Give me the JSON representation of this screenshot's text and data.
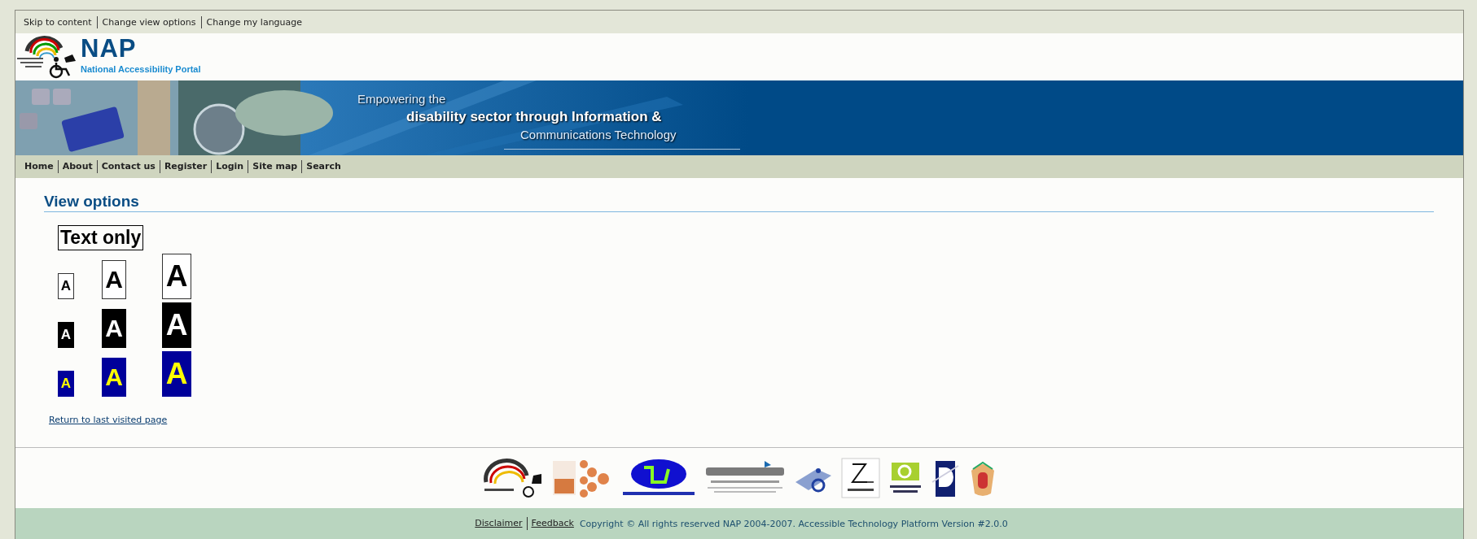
{
  "skip_links": [
    "Skip to content",
    "Change view options",
    "Change my language"
  ],
  "logo": {
    "name": "NAP",
    "subtitle": "National Accessibility Portal"
  },
  "banner": {
    "kind": "picture",
    "tagline": [
      "Empowering the",
      "disability sector through Information &",
      "Communications Technology"
    ]
  },
  "nav": [
    "Home",
    "About",
    "Contact us",
    "Register",
    "Login",
    "Site map",
    "Search"
  ],
  "view_options": {
    "title": "View options",
    "text_only": "Text only",
    "schemes": [
      {
        "kind": "outline",
        "sizes": [
          "A",
          "A",
          "A"
        ]
      },
      {
        "kind": "inverse",
        "sizes": [
          "A",
          "A",
          "A"
        ]
      },
      {
        "kind": "yellow-on-blue",
        "sizes": [
          "A",
          "A",
          "A"
        ]
      }
    ],
    "return_link": "Return to last visited page"
  },
  "partner_logos": [
    {
      "kind": "rainbow"
    },
    {
      "kind": "dots"
    },
    {
      "kind": "ellipse"
    },
    {
      "kind": "wordmark"
    },
    {
      "kind": "wheelchair"
    },
    {
      "kind": "arrow"
    },
    {
      "kind": "green"
    },
    {
      "kind": "d"
    },
    {
      "kind": "crest"
    }
  ],
  "footer": {
    "links": [
      "Disclaimer",
      "Feedback"
    ],
    "copyright": "Copyright © All rights reserved NAP 2004-2007. Accessible Technology Platform Version #2.0.0"
  }
}
